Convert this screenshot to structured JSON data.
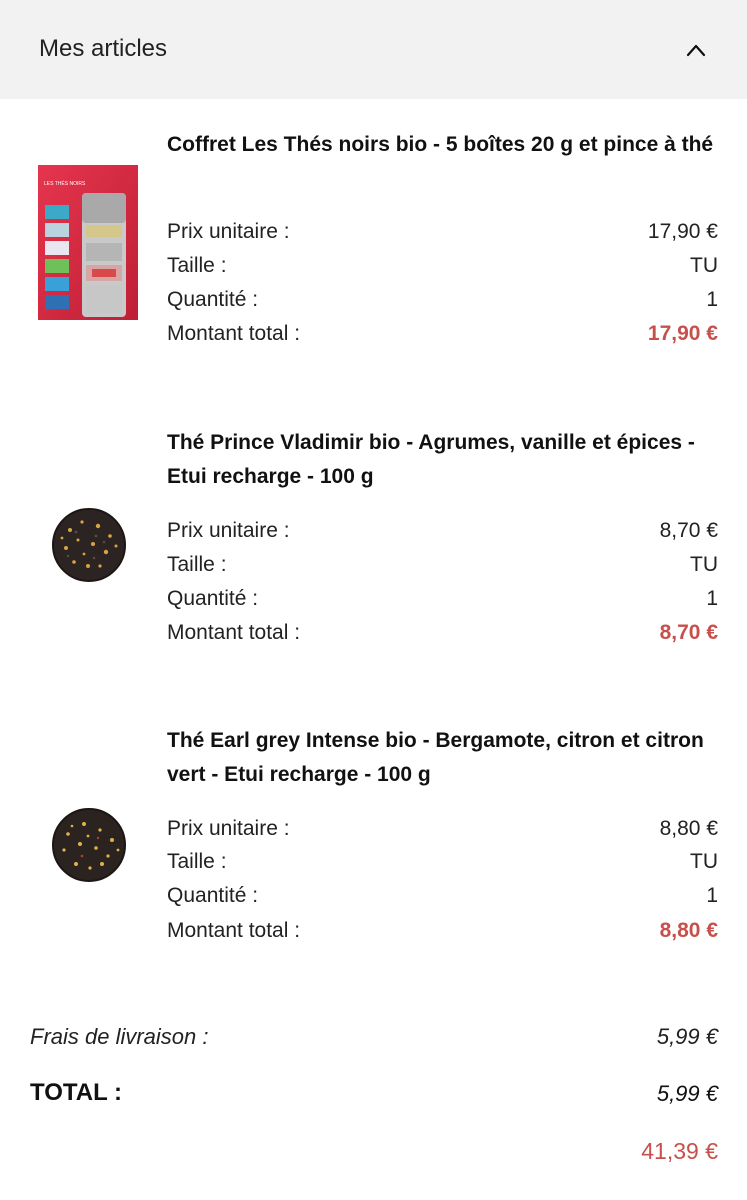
{
  "section": {
    "title": "Mes articles",
    "toggle_icon": "chevron-up-icon"
  },
  "items": [
    {
      "name": "Coffret Les Thés noirs bio - 5 boîtes 20 g et pince à thé",
      "image": "tea-gift-box-icon",
      "unit_price_label": "Prix unitaire :",
      "unit_price": "17,90 €",
      "size_label": "Taille :",
      "size": "TU",
      "quantity_label": "Quantité :",
      "quantity": "1",
      "total_label": "Montant total :",
      "total": "17,90 €"
    },
    {
      "name": "Thé Prince Vladimir bio - Agrumes, vanille et épices - Etui recharge - 100 g",
      "image": "loose-leaf-tea-icon",
      "unit_price_label": "Prix unitaire :",
      "unit_price": "8,70 €",
      "size_label": "Taille :",
      "size": "TU",
      "quantity_label": "Quantité :",
      "quantity": "1",
      "total_label": "Montant total :",
      "total": "8,70 €"
    },
    {
      "name": "Thé Earl grey Intense bio - Bergamote, citron et citron vert - Etui recharge - 100 g",
      "image": "loose-leaf-tea-icon",
      "unit_price_label": "Prix unitaire :",
      "unit_price": "8,80 €",
      "size_label": "Taille :",
      "size": "TU",
      "quantity_label": "Quantité :",
      "quantity": "1",
      "total_label": "Montant total :",
      "total": "8,80 €"
    }
  ],
  "summary": {
    "shipping_label": "Frais de livraison :",
    "shipping_value": "5,99 €",
    "total_label": "TOTAL :",
    "total_value": "5,99 €",
    "grand_total": "41,39 €"
  },
  "colors": {
    "header_bg": "#f2f2f2",
    "accent_price": "#c8504c",
    "text": "#111111"
  }
}
